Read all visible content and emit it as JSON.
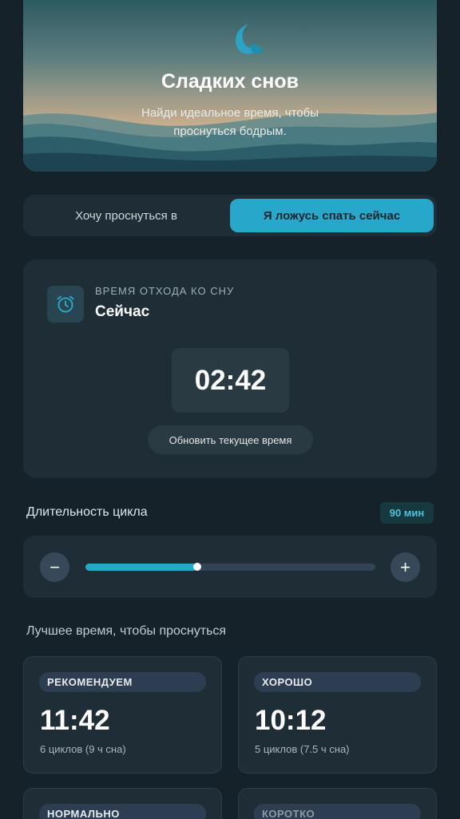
{
  "hero": {
    "title": "Сладких снов",
    "subtitle_line1": "Найди идеальное время, чтобы",
    "subtitle_line2": "проснуться бодрым."
  },
  "mode_toggle": {
    "option_wake": "Хочу проснуться в",
    "option_sleep_now": "Я ложусь спать сейчас",
    "selected": "Я ложусь спать сейчас"
  },
  "bedtime_card": {
    "label": "ВРЕМЯ ОТХОДА КО СНУ",
    "value": "Сейчас",
    "time": "02:42",
    "refresh_label": "Обновить текущее время"
  },
  "cycle": {
    "label": "Длительность цикла",
    "badge": "90 мин",
    "slider_fraction": 0.385,
    "minus": "−",
    "plus": "+"
  },
  "results": {
    "heading": "Лучшее время, чтобы проснуться",
    "cards": [
      {
        "tag": "РЕКОМЕНДУЕМ",
        "time": "11:42",
        "detail": "6 циклов (9 ч сна)"
      },
      {
        "tag": "ХОРОШО",
        "time": "10:12",
        "detail": "5 циклов (7.5 ч сна)"
      },
      {
        "tag": "НОРМАЛЬНО",
        "time": "",
        "detail": ""
      },
      {
        "tag": "КОРОТКО",
        "time": "",
        "detail": ""
      }
    ]
  },
  "colors": {
    "accent": "#27a7c9",
    "background": "#15222a",
    "card": "#1f2e36"
  }
}
